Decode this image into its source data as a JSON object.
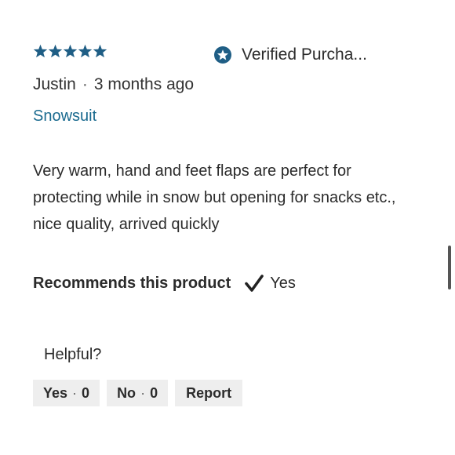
{
  "review": {
    "rating": 5,
    "rating_max": 5,
    "star_color": "#1f5e85",
    "verified_label": "Verified Purcha...",
    "verified_color": "#1f5e85",
    "reviewer_name": "Justin",
    "separator": "·",
    "time_ago": "3 months ago",
    "product_name": "Snowsuit",
    "body": "Very warm, hand and feet flaps are perfect for protecting while in snow but opening for snacks etc., nice quality, arrived quickly",
    "recommends_label": "Recommends this product",
    "recommends_icon": "checkmark-icon",
    "recommends_value": "Yes"
  },
  "feedback": {
    "helpful_label": "Helpful?",
    "yes_label": "Yes",
    "yes_count": "0",
    "no_label": "No",
    "no_count": "0",
    "separator": "·",
    "report_label": "Report"
  }
}
